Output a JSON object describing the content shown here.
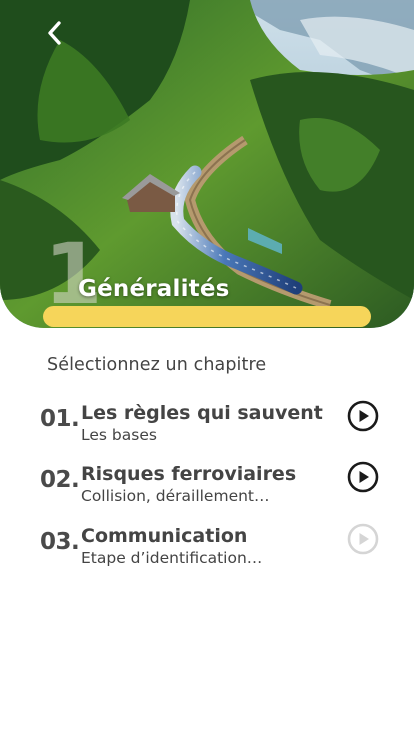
{
  "hero": {
    "number": "1",
    "title": "Généralités",
    "progress_fraction": 1.0,
    "progress_color": "#f6d55a"
  },
  "subtitle": "Sélectionnez un chapitre",
  "chapters": [
    {
      "number": "01.",
      "title": "Les règles qui sauvent",
      "subtitle": "Les bases",
      "enabled": true
    },
    {
      "number": "02.",
      "title": "Risques ferroviaires",
      "subtitle": "Collision, déraillement…",
      "enabled": true
    },
    {
      "number": "03.",
      "title": "Communication",
      "subtitle": "Etape d’identification…",
      "enabled": false
    }
  ],
  "icons": {
    "back": "chevron-left-icon",
    "play": "play-circle-icon"
  },
  "colors": {
    "accent_yellow": "#f6d55a",
    "text_dark": "#444444",
    "play_enabled": "#1a1a1a",
    "play_disabled": "#d5d5d5"
  }
}
